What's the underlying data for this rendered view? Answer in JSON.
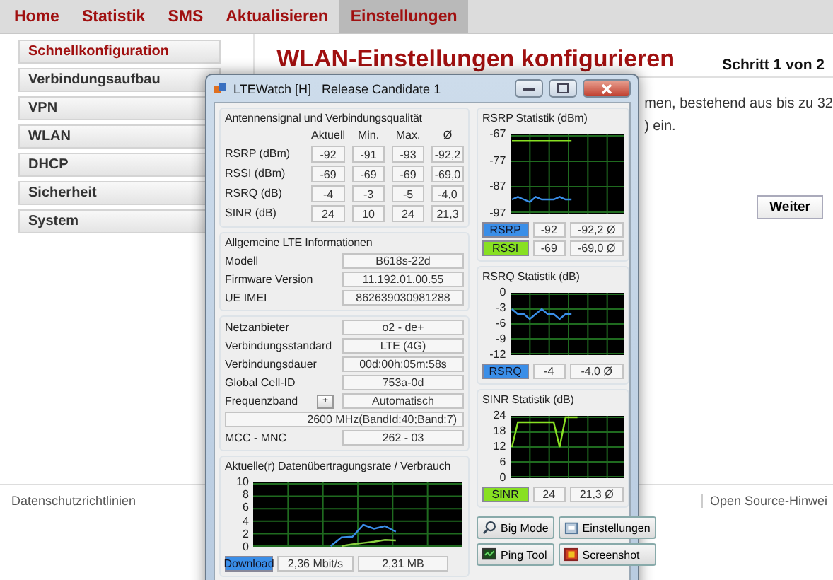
{
  "browser_page": {
    "nav_tabs": [
      {
        "label": "Home",
        "selected": false
      },
      {
        "label": "Statistik",
        "selected": false
      },
      {
        "label": "SMS",
        "selected": false
      },
      {
        "label": "Aktualisieren",
        "selected": false
      },
      {
        "label": "Einstellungen",
        "selected": true
      }
    ],
    "sidebar": [
      {
        "label": "Schnellkonfiguration",
        "selected": true
      },
      {
        "label": "Verbindungsaufbau",
        "selected": false
      },
      {
        "label": "VPN",
        "selected": false
      },
      {
        "label": "WLAN",
        "selected": false
      },
      {
        "label": "DHCP",
        "selected": false
      },
      {
        "label": "Sicherheit",
        "selected": false
      },
      {
        "label": "System",
        "selected": false
      }
    ],
    "heading": "WLAN-Einstellungen konfigurieren",
    "step": "Schritt 1 von 2",
    "body_lines": [
      "men, bestehend aus bis zu 32",
      ") ein."
    ],
    "next_button": "Weiter",
    "footer": {
      "left": "Datenschutzrichtlinien",
      "right": "Open Source-Hinwei"
    }
  },
  "lte_window": {
    "title": "LTEWatch [H]   Release Candidate 1",
    "signal": {
      "title": "Antennensignal und Verbindungsqualität",
      "columns": [
        "Aktuell",
        "Min.",
        "Max.",
        "Ø"
      ],
      "rows": [
        {
          "label": "RSRP (dBm)",
          "values": [
            "-92",
            "-91",
            "-93",
            "-92,2"
          ]
        },
        {
          "label": "RSSI (dBm)",
          "values": [
            "-69",
            "-69",
            "-69",
            "-69,0"
          ]
        },
        {
          "label": "RSRQ (dB)",
          "values": [
            "-4",
            "-3",
            "-5",
            "-4,0"
          ]
        },
        {
          "label": "SINR (dB)",
          "values": [
            "24",
            "10",
            "24",
            "21,3"
          ]
        }
      ]
    },
    "lte_info": {
      "title": "Allgemeine LTE Informationen",
      "fields": [
        {
          "label": "Modell",
          "value": "B618s-22d"
        },
        {
          "label": "Firmware Version",
          "value": "11.192.01.00.55"
        },
        {
          "label": "UE IMEI",
          "value": "862639030981288"
        }
      ]
    },
    "network": [
      {
        "kind": "field",
        "label": "Netzanbieter",
        "value": "o2 - de+"
      },
      {
        "kind": "field",
        "label": "Verbindungsstandard",
        "value": "LTE (4G)"
      },
      {
        "kind": "field",
        "label": "Verbindungsdauer",
        "value": "00d:00h:05m:58s"
      },
      {
        "kind": "field",
        "label": "Global Cell-ID",
        "value": "753a-0d"
      },
      {
        "kind": "band",
        "label": "Frequenzband",
        "button": "+",
        "value": "Automatisch"
      },
      {
        "kind": "wide",
        "value": "2600 MHz(BandId:40;Band:7)"
      },
      {
        "kind": "field",
        "label": "MCC - MNC",
        "value": "262 - 03"
      }
    ],
    "data_rate": {
      "title": "Aktuelle(r) Datenübertragungsrate / Verbrauch",
      "chart_data": {
        "type": "line",
        "grid": true,
        "ylim": [
          0,
          10
        ],
        "yticks": [
          0,
          2,
          4,
          6,
          8,
          10
        ],
        "series": [
          {
            "name": "Download",
            "color": "#3a8ee8",
            "values": [
              null,
              null,
              null,
              null,
              null,
              null,
              null,
              0,
              1.4,
              1.5,
              3.4,
              2.8,
              3.2,
              2.3,
              null,
              null,
              null,
              null,
              null,
              null
            ]
          },
          {
            "color": "#8ad040",
            "values": [
              null,
              null,
              null,
              null,
              null,
              null,
              null,
              null,
              0,
              0.3,
              0.5,
              0.7,
              1.0,
              0.9,
              null,
              null,
              null,
              null,
              null,
              null
            ]
          }
        ]
      },
      "legend": {
        "rate": "2,36 Mbit/s",
        "volume": "2,31 MB"
      }
    },
    "stats": [
      {
        "title": "RSRP Statistik (dBm)",
        "chart_data": {
          "type": "line",
          "grid": true,
          "ylim": [
            -97,
            -67
          ],
          "yticks": [
            -67,
            -77,
            -87,
            -97
          ],
          "series": [
            {
              "name": "RSRP",
              "color": "#3a8ee8",
              "values": [
                -92,
                -91,
                -92,
                -93,
                -91,
                -92,
                -92,
                -92,
                -91,
                -92,
                -92,
                null,
                null,
                null,
                null,
                null,
                null,
                null,
                null,
                null
              ]
            },
            {
              "name": "RSSI",
              "color": "#88e022",
              "values": [
                -69,
                -69,
                -69,
                -69,
                -69,
                -69,
                -69,
                -69,
                -69,
                -69,
                -69,
                null,
                null,
                null,
                null,
                null,
                null,
                null,
                null,
                null
              ]
            }
          ]
        },
        "legend": [
          {
            "current": "-92",
            "average": "-92,2 Ø"
          },
          {
            "current": "-69",
            "average": "-69,0 Ø"
          }
        ]
      },
      {
        "title": "RSRQ Statistik (dB)",
        "chart_data": {
          "type": "line",
          "grid": true,
          "ylim": [
            -12,
            0
          ],
          "yticks": [
            0,
            -3,
            -6,
            -9,
            -12
          ],
          "series": [
            {
              "name": "RSRQ",
              "color": "#3a8ee8",
              "values": [
                -3,
                -4,
                -4,
                -5,
                -4,
                -3,
                -4,
                -4,
                -5,
                -4,
                -4,
                null,
                null,
                null,
                null,
                null,
                null,
                null,
                null,
                null
              ]
            }
          ]
        },
        "legend": [
          {
            "current": "-4",
            "average": "-4,0 Ø"
          }
        ]
      },
      {
        "title": "SINR Statistik (dB)",
        "chart_data": {
          "type": "line",
          "grid": true,
          "ylim": [
            0,
            24
          ],
          "yticks": [
            24,
            18,
            12,
            6,
            0
          ],
          "series": [
            {
              "name": "SINR",
              "color": "#88e022",
              "values": [
                12,
                22,
                22,
                22,
                22,
                22,
                22,
                22,
                12,
                24,
                24,
                24,
                null,
                null,
                null,
                null,
                null,
                null,
                null,
                null
              ]
            }
          ]
        },
        "legend": [
          {
            "current": "24",
            "average": "21,3 Ø"
          }
        ]
      }
    ],
    "buttons": [
      {
        "kind": "magnifier",
        "label": "Big Mode"
      },
      {
        "kind": "settings",
        "label": "Einstellungen"
      },
      {
        "kind": "monitor",
        "label": "Ping Tool"
      },
      {
        "kind": "camera",
        "label": "Screenshot"
      }
    ]
  }
}
